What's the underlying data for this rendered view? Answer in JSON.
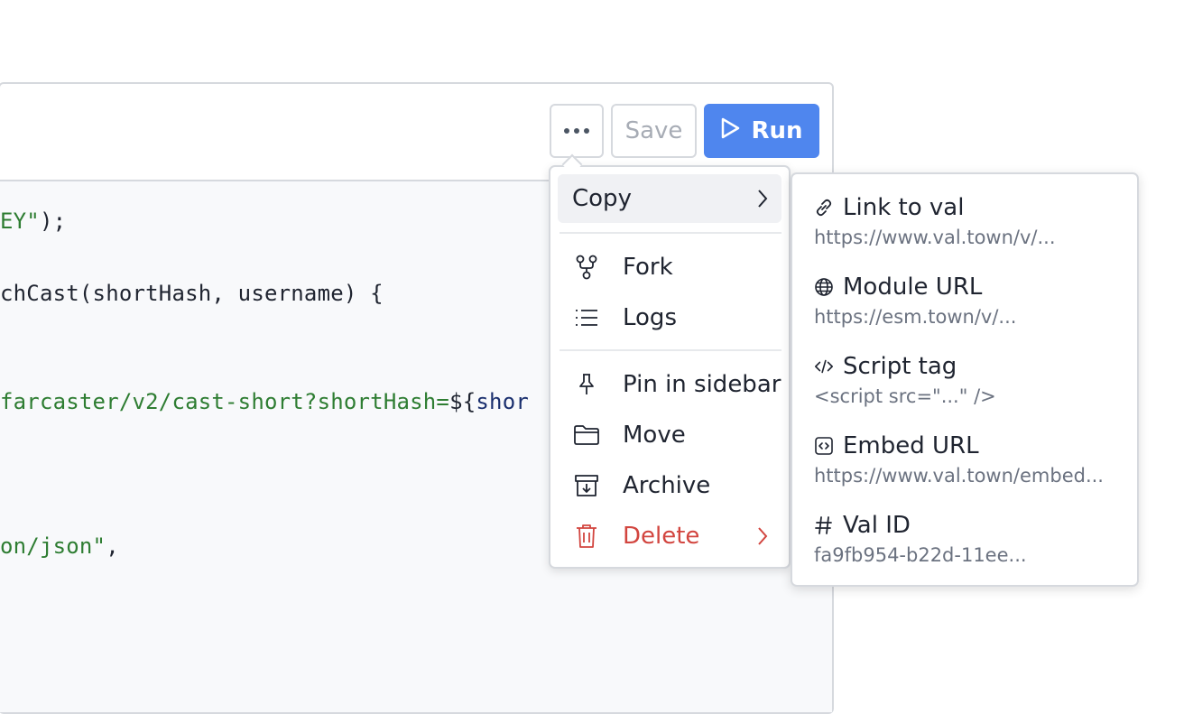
{
  "toolbar": {
    "more_label": "more-options",
    "save_label": "Save",
    "run_label": "Run",
    "run_color": "#4f86ee"
  },
  "code": {
    "lines": [
      {
        "segments": [
          {
            "t": "EY\"",
            "c": "s"
          },
          {
            "t": ");",
            "c": ""
          }
        ]
      },
      {
        "segments": [
          {
            "t": "chCast(shortHash, username) {",
            "c": ""
          }
        ]
      },
      {
        "segments": [
          {
            "t": "farcaster/v2/cast-short?shortHash=",
            "c": "s"
          },
          {
            "t": "${",
            "c": ""
          },
          {
            "t": "shor",
            "c": "v"
          }
        ]
      },
      {
        "segments": [
          {
            "t": "on/json\"",
            "c": "s"
          },
          {
            "t": ",",
            "c": ""
          }
        ]
      }
    ]
  },
  "menu": {
    "items": [
      {
        "label": "Copy",
        "icon": "none",
        "has_submenu": true,
        "active": true
      },
      {
        "label": "Fork",
        "icon": "fork-icon"
      },
      {
        "label": "Logs",
        "icon": "list-icon"
      },
      {
        "label": "Pin in sidebar",
        "icon": "pin-icon"
      },
      {
        "label": "Move",
        "icon": "folder-icon"
      },
      {
        "label": "Archive",
        "icon": "archive-icon"
      },
      {
        "label": "Delete",
        "icon": "trash-icon",
        "has_submenu": true,
        "danger": true
      }
    ]
  },
  "submenu": {
    "items": [
      {
        "label": "Link to val",
        "desc": "https://www.val.town/v/...",
        "icon": "link-icon"
      },
      {
        "label": "Module URL",
        "desc": "https://esm.town/v/...",
        "icon": "globe-icon"
      },
      {
        "label": "Script tag",
        "desc": "<script src=\"...\" />",
        "icon": "code-icon"
      },
      {
        "label": "Embed URL",
        "desc": "https://www.val.town/embed...",
        "icon": "embed-icon"
      },
      {
        "label": "Val ID",
        "desc": "fa9fb954-b22d-11ee...",
        "icon": "hash-icon"
      }
    ]
  }
}
